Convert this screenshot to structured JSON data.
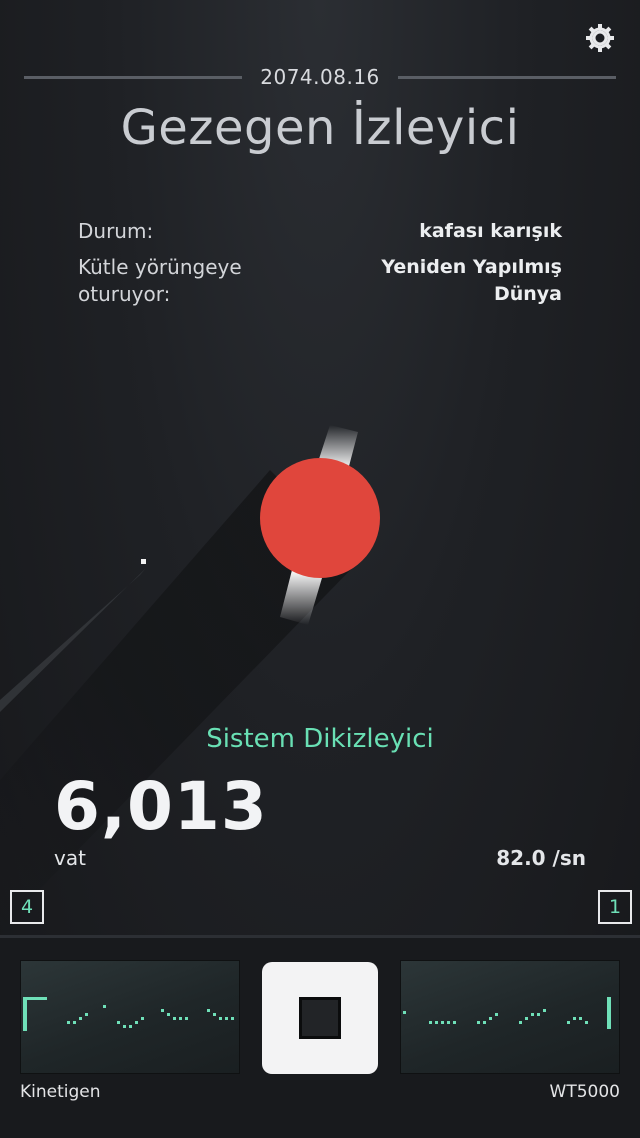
{
  "header": {
    "date": "2074.08.16",
    "title": "Gezegen İzleyici",
    "settings_icon": "gear-icon"
  },
  "info": {
    "status_label": "Durum:",
    "status_value": "kafası karışık",
    "mass_label_line1": "Kütle yörüngeye",
    "mass_label_line2": "oturuyor:",
    "mass_value_line1": "Yeniden Yapılmış",
    "mass_value_line2": "Dünya"
  },
  "planet": {
    "color": "#e0463c"
  },
  "stats": {
    "title": "Sistem Dikizleyici",
    "value": "6,013",
    "unit": "vat",
    "rate": "82.0 /sn",
    "left_count": "4",
    "right_count": "1"
  },
  "panel": {
    "left_label": "Kinetigen",
    "right_label": "WT5000",
    "stop_icon": "stop-icon",
    "accent": "#6fe0b8"
  }
}
